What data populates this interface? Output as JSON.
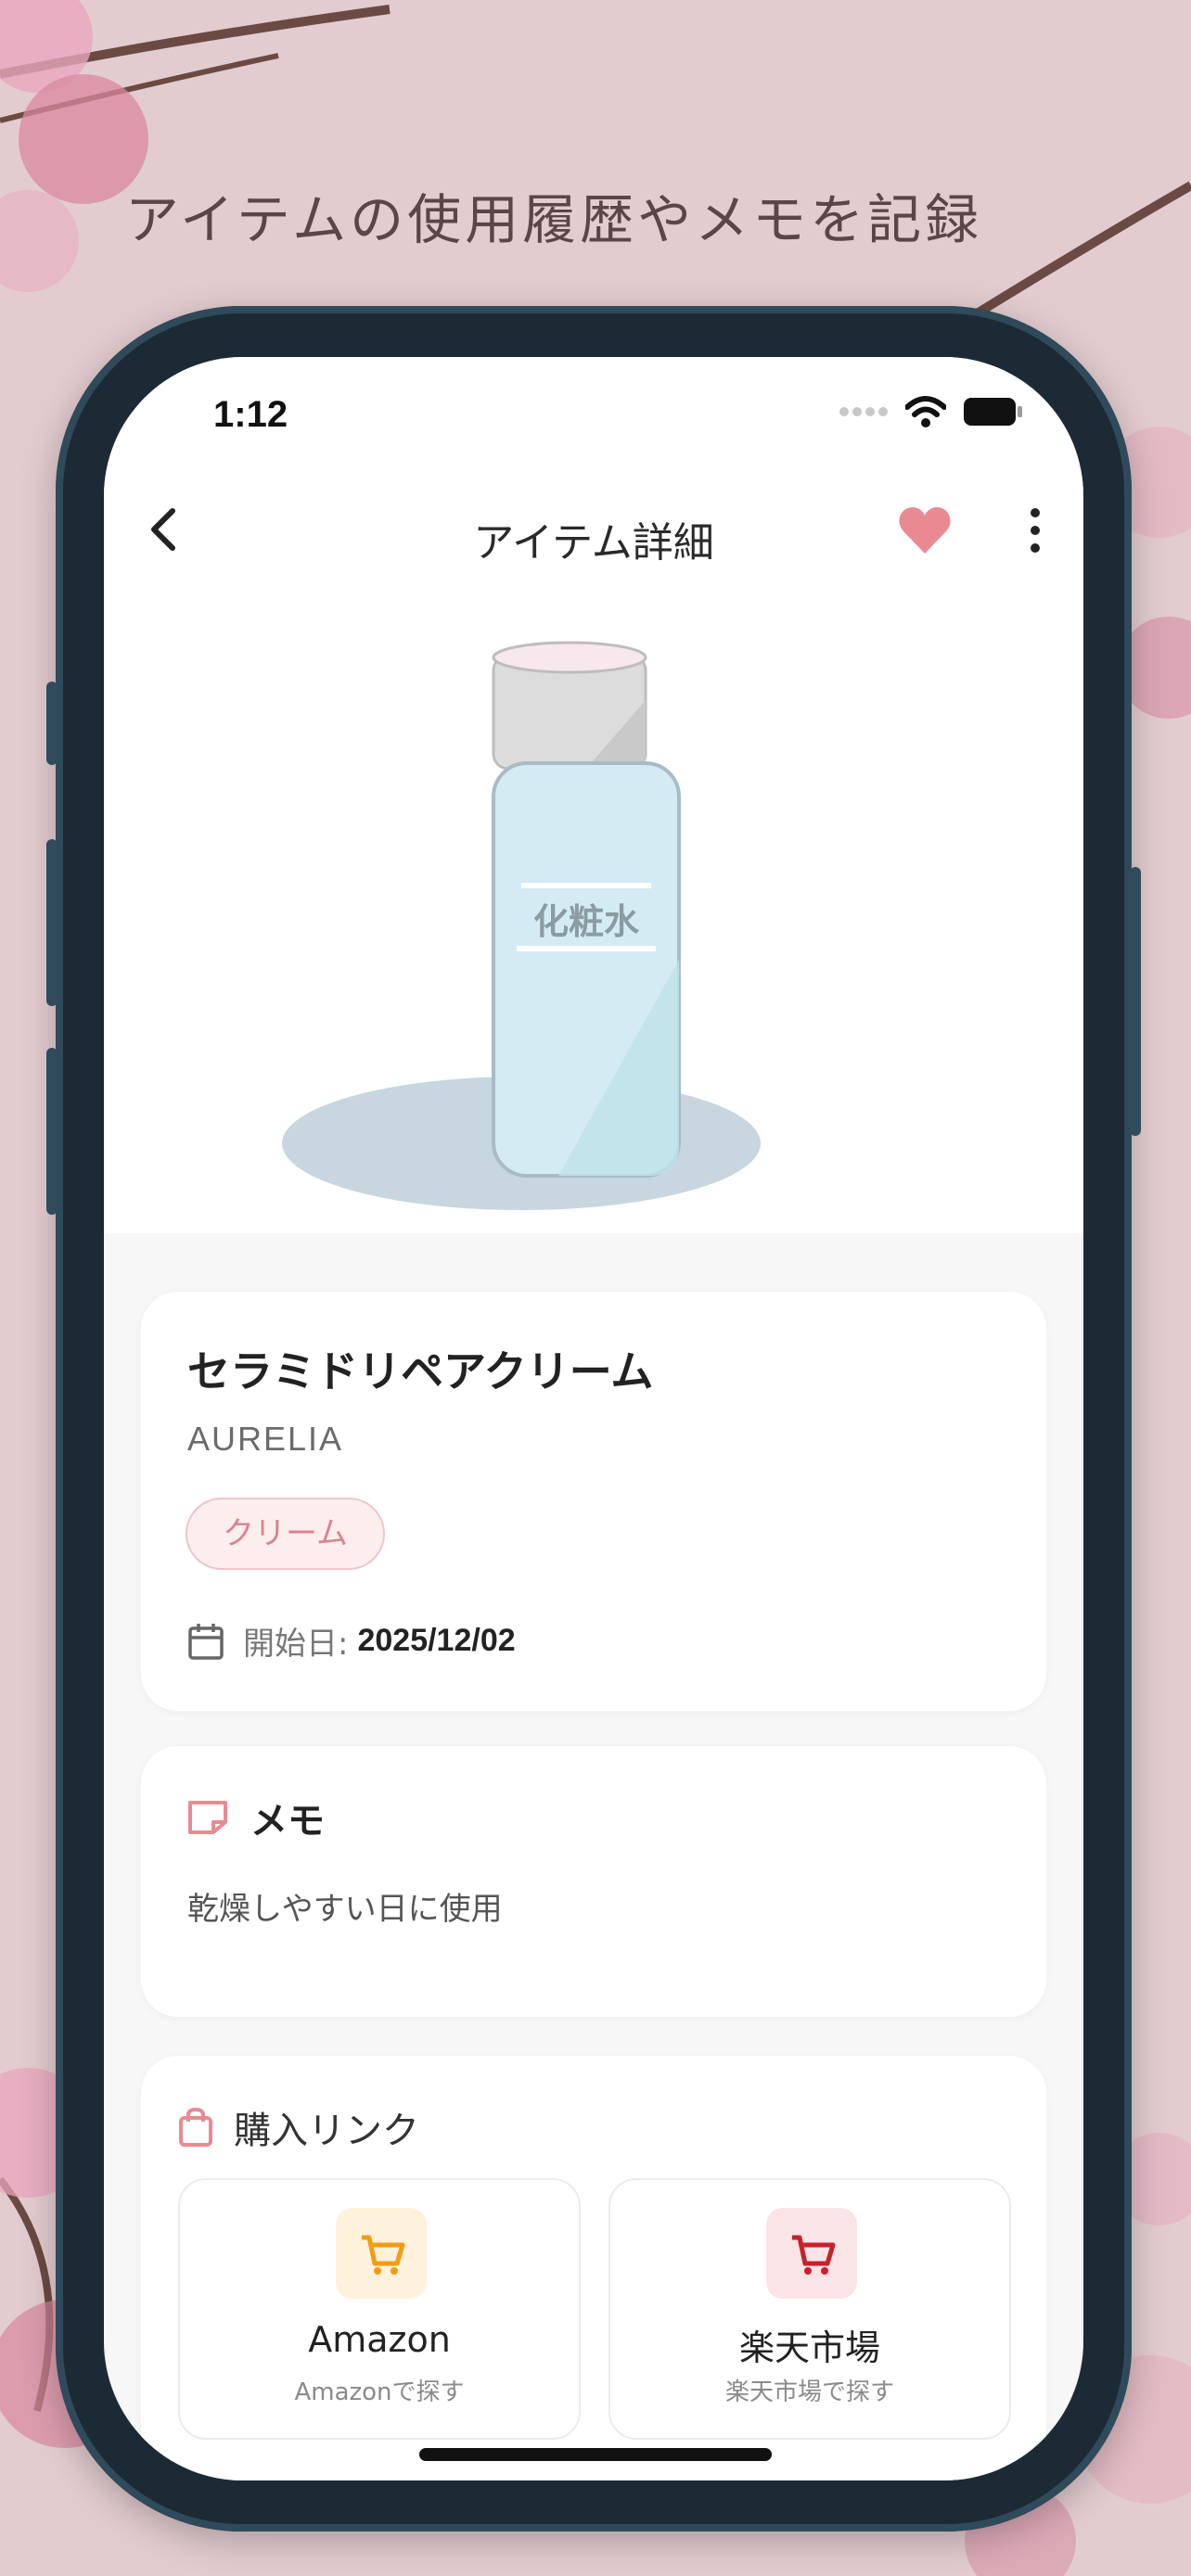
{
  "caption": "アイテムの使用履歴やメモを記録",
  "status_bar": {
    "time": "1:12"
  },
  "nav": {
    "title": "アイテム詳細"
  },
  "hero": {
    "bottle_label": "化粧水"
  },
  "item": {
    "name": "セラミドリペアクリーム",
    "brand": "AURELIA",
    "category": "クリーム",
    "start_date_label": "開始日:",
    "start_date": "2025/12/02"
  },
  "memo": {
    "title": "メモ",
    "text": "乾燥しやすい日に使用"
  },
  "purchase_links": {
    "title": "購入リンク",
    "stores": [
      {
        "name": "Amazon",
        "sub": "Amazonで探す",
        "icon": "cart-icon",
        "color": "#f39c12"
      },
      {
        "name": "楽天市場",
        "sub": "楽天市場で探す",
        "icon": "cart-icon",
        "color": "#c8202c"
      }
    ]
  },
  "colors": {
    "accent_pink": "#e98a93",
    "background": "#e3cccf",
    "frame": "#1c2a35"
  }
}
